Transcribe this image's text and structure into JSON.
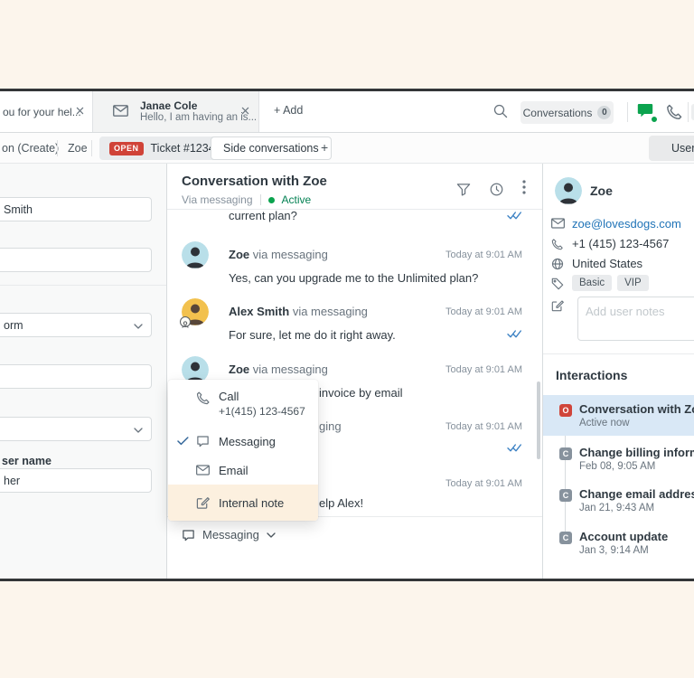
{
  "topbar": {
    "tab_prev": {
      "title": "ou for your hel..."
    },
    "tab_active": {
      "name": "Janae Cole",
      "preview": "Hello, I am having an is..."
    },
    "add_label": "+ Add",
    "conversations": {
      "label": "Conversations",
      "count": "0"
    }
  },
  "tabrow": {
    "breadcrumb": "on (Create)",
    "tab_zoe": "Zoe",
    "ticket": {
      "status": "OPEN",
      "label": "Ticket #1234"
    },
    "side_conversations": "Side conversations",
    "add_tab": "+",
    "user_button": "User"
  },
  "left_form": {
    "field_name_value": "Smith",
    "select_form_value": "orm",
    "label_user_name": "ser name",
    "field_user_name_value": "her"
  },
  "conversation": {
    "title": "Conversation with Zoe",
    "via": "Via messaging",
    "status": "Active",
    "messages": [
      {
        "text": "current plan?"
      },
      {
        "sender": "Zoe",
        "via": "via messaging",
        "time": "Today at 9:01 AM",
        "text": "Yes, can you upgrade me to the Unlimited plan?"
      },
      {
        "sender": "Alex Smith",
        "via": "via messaging",
        "time": "Today at 9:01 AM",
        "text": "For sure, let me do it right away."
      },
      {
        "sender": "Zoe",
        "via": "via messaging",
        "time": "Today at 9:01 AM",
        "text": "invoice by email"
      },
      {
        "via": "ging",
        "time": "Today at 9:01 AM"
      },
      {
        "time": "Today at 9:01 AM",
        "text": "elp Alex!"
      }
    ],
    "composer": {
      "channel": "Messaging"
    }
  },
  "context_menu": {
    "call_label": "Call",
    "call_number": "+1(415) 123-4567",
    "messaging_label": "Messaging",
    "email_label": "Email",
    "internal_note_label": "Internal note"
  },
  "user_panel": {
    "name": "Zoe",
    "email": "zoe@lovesdogs.com",
    "phone": "+1 (415) 123-4567",
    "country": "United States",
    "tags": [
      "Basic",
      "VIP"
    ],
    "notes_placeholder": "Add user notes",
    "interactions_title": "Interactions",
    "interactions": [
      {
        "badge": "O",
        "title": "Conversation with Zoe",
        "subtitle": "Active now"
      },
      {
        "badge": "C",
        "title": "Change billing information",
        "subtitle": "Feb 08, 9:05 AM"
      },
      {
        "badge": "C",
        "title": "Change email address",
        "subtitle": "Jan 21, 9:43 AM"
      },
      {
        "badge": "C",
        "title": "Account update",
        "subtitle": "Jan 3, 9:14 AM"
      }
    ]
  },
  "colors": {
    "accent_blue": "#1f73b7",
    "messaging_green": "#0ba34e",
    "active_green": "#038153",
    "open_red": "#d04338",
    "menu_highlight": "#fcf0df",
    "interaction_highlight": "#d9e8f6"
  }
}
